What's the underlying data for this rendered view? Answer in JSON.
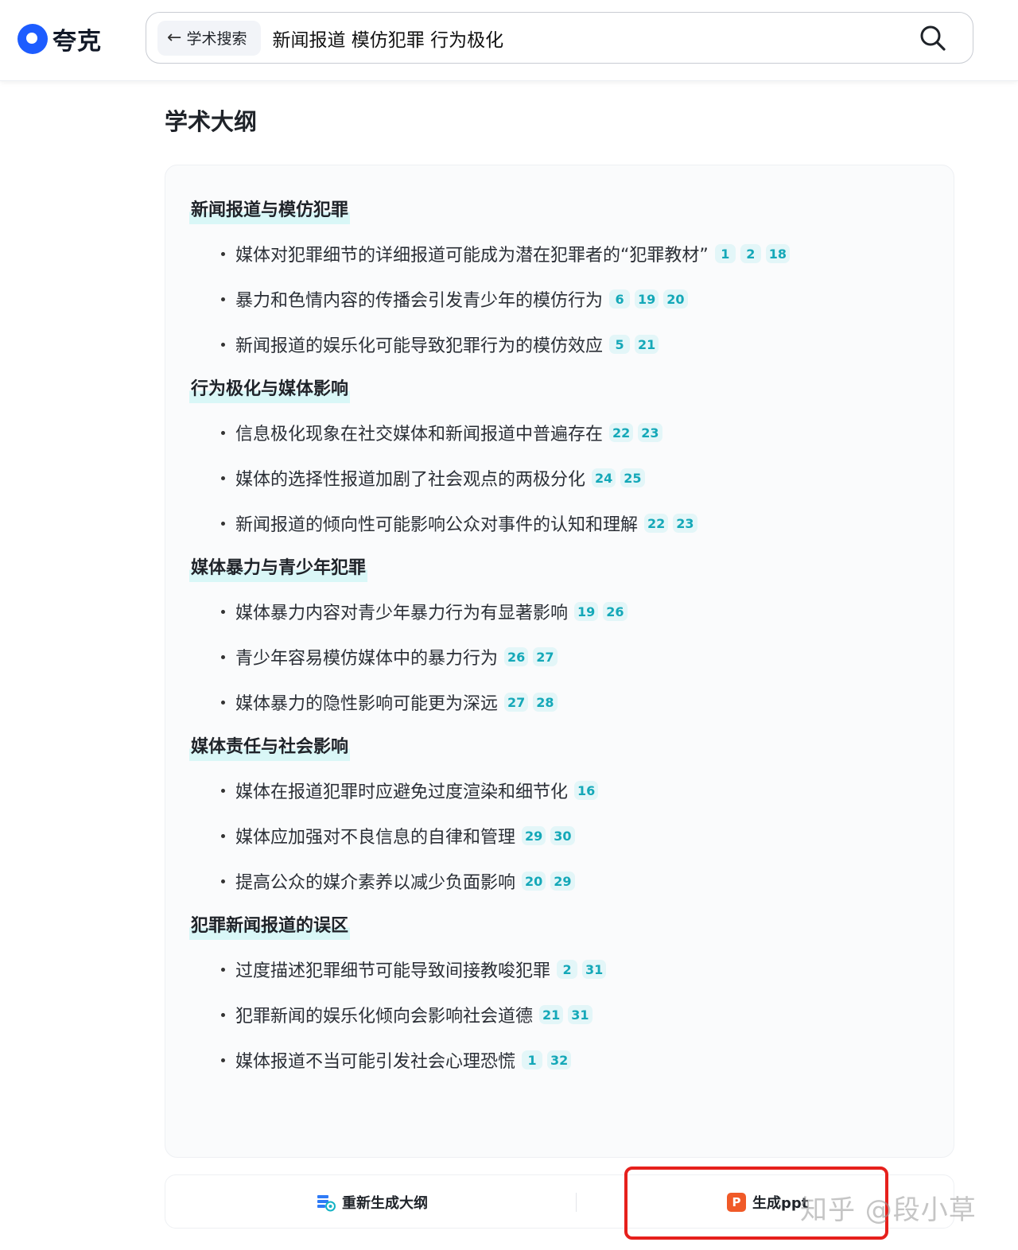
{
  "header": {
    "logo_text": "夸克",
    "chip_label": "学术搜索",
    "query": "新闻报道 模仿犯罪 行为极化"
  },
  "page_title": "学术大纲",
  "groups": [
    {
      "title": "新闻报道与模仿犯罪",
      "items": [
        {
          "text": "媒体对犯罪细节的详细报道可能成为潜在犯罪者的“犯罪教材”",
          "refs": [
            "1",
            "2",
            "18"
          ]
        },
        {
          "text": "暴力和色情内容的传播会引发青少年的模仿行为",
          "refs": [
            "6",
            "19",
            "20"
          ]
        },
        {
          "text": "新闻报道的娱乐化可能导致犯罪行为的模仿效应",
          "refs": [
            "5",
            "21"
          ]
        }
      ]
    },
    {
      "title": "行为极化与媒体影响",
      "items": [
        {
          "text": "信息极化现象在社交媒体和新闻报道中普遍存在",
          "refs": [
            "22",
            "23"
          ]
        },
        {
          "text": "媒体的选择性报道加剧了社会观点的两极分化",
          "refs": [
            "24",
            "25"
          ]
        },
        {
          "text": "新闻报道的倾向性可能影响公众对事件的认知和理解",
          "refs": [
            "22",
            "23"
          ]
        }
      ]
    },
    {
      "title": "媒体暴力与青少年犯罪",
      "items": [
        {
          "text": "媒体暴力内容对青少年暴力行为有显著影响",
          "refs": [
            "19",
            "26"
          ]
        },
        {
          "text": "青少年容易模仿媒体中的暴力行为",
          "refs": [
            "26",
            "27"
          ]
        },
        {
          "text": "媒体暴力的隐性影响可能更为深远",
          "refs": [
            "27",
            "28"
          ]
        }
      ]
    },
    {
      "title": "媒体责任与社会影响",
      "items": [
        {
          "text": "媒体在报道犯罪时应避免过度渲染和细节化",
          "refs": [
            "16"
          ]
        },
        {
          "text": "媒体应加强对不良信息的自律和管理",
          "refs": [
            "29",
            "30"
          ]
        },
        {
          "text": "提高公众的媒介素养以减少负面影响",
          "refs": [
            "20",
            "29"
          ]
        }
      ]
    },
    {
      "title": "犯罪新闻报道的误区",
      "items": [
        {
          "text": "过度描述犯罪细节可能导致间接教唆犯罪",
          "refs": [
            "2",
            "31"
          ]
        },
        {
          "text": "犯罪新闻的娱乐化倾向会影响社会道德",
          "refs": [
            "21",
            "31"
          ]
        },
        {
          "text": "媒体报道不当可能引发社会心理恐慌",
          "refs": [
            "1",
            "32"
          ]
        }
      ]
    }
  ],
  "actions": {
    "regenerate_label": "重新生成大纲",
    "ppt_label": "生成ppt",
    "ppt_icon_letter": "P"
  },
  "watermark": "知乎 @段小草",
  "colors": {
    "brand": "#1d5cff",
    "ref_bg": "#e3f6f8",
    "ref_text": "#14a8b8",
    "highlight": "#e6201c"
  }
}
